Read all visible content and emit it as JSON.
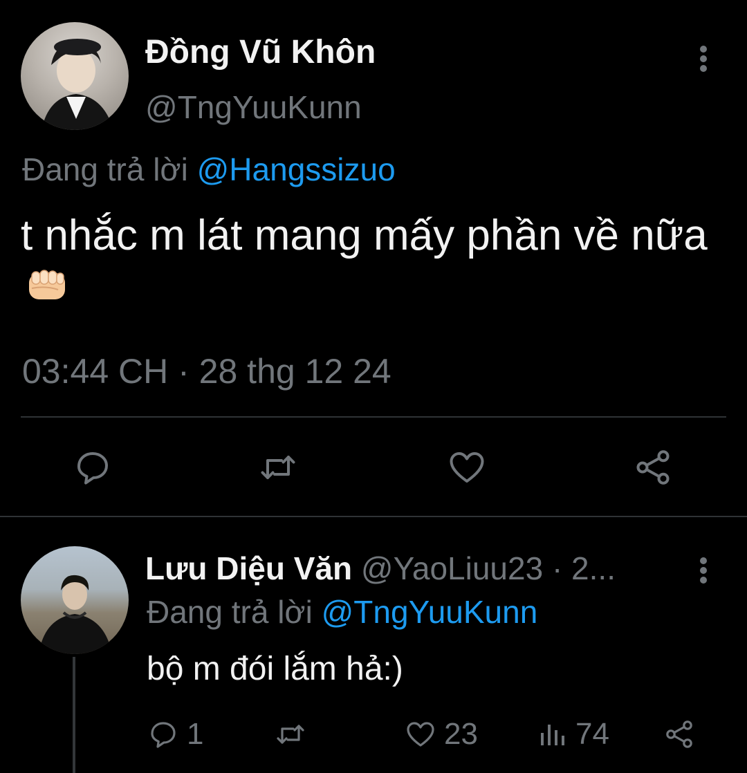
{
  "main_tweet": {
    "display_name": "Đồng Vũ Khôn",
    "handle": "@TngYuuKunn",
    "reply_prefix": "Đang trả lời",
    "reply_to": "@Hangssizuo",
    "text": "t nhắc m lát mang mấy phần về nữa",
    "emoji_icon": "oncoming-fist-icon",
    "timestamp": "03:44 CH · 28 thg 12 24",
    "actions": [
      "reply-icon",
      "retweet-icon",
      "like-icon",
      "share-icon"
    ]
  },
  "reply_tweet": {
    "display_name": "Lưu Diệu Văn",
    "handle_and_time": "@YaoLiuu23 · 2...",
    "reply_prefix": "Đang trả lời",
    "reply_to": "@TngYuuKunn",
    "text": "bộ m đói lắm hả:)",
    "reply_count": "1",
    "like_count": "23",
    "view_count": "74"
  },
  "colors": {
    "background": "#000000",
    "text_primary": "#f2f2f2",
    "text_secondary": "#71767b",
    "accent": "#1d9bf0",
    "divider": "#2f3336"
  }
}
